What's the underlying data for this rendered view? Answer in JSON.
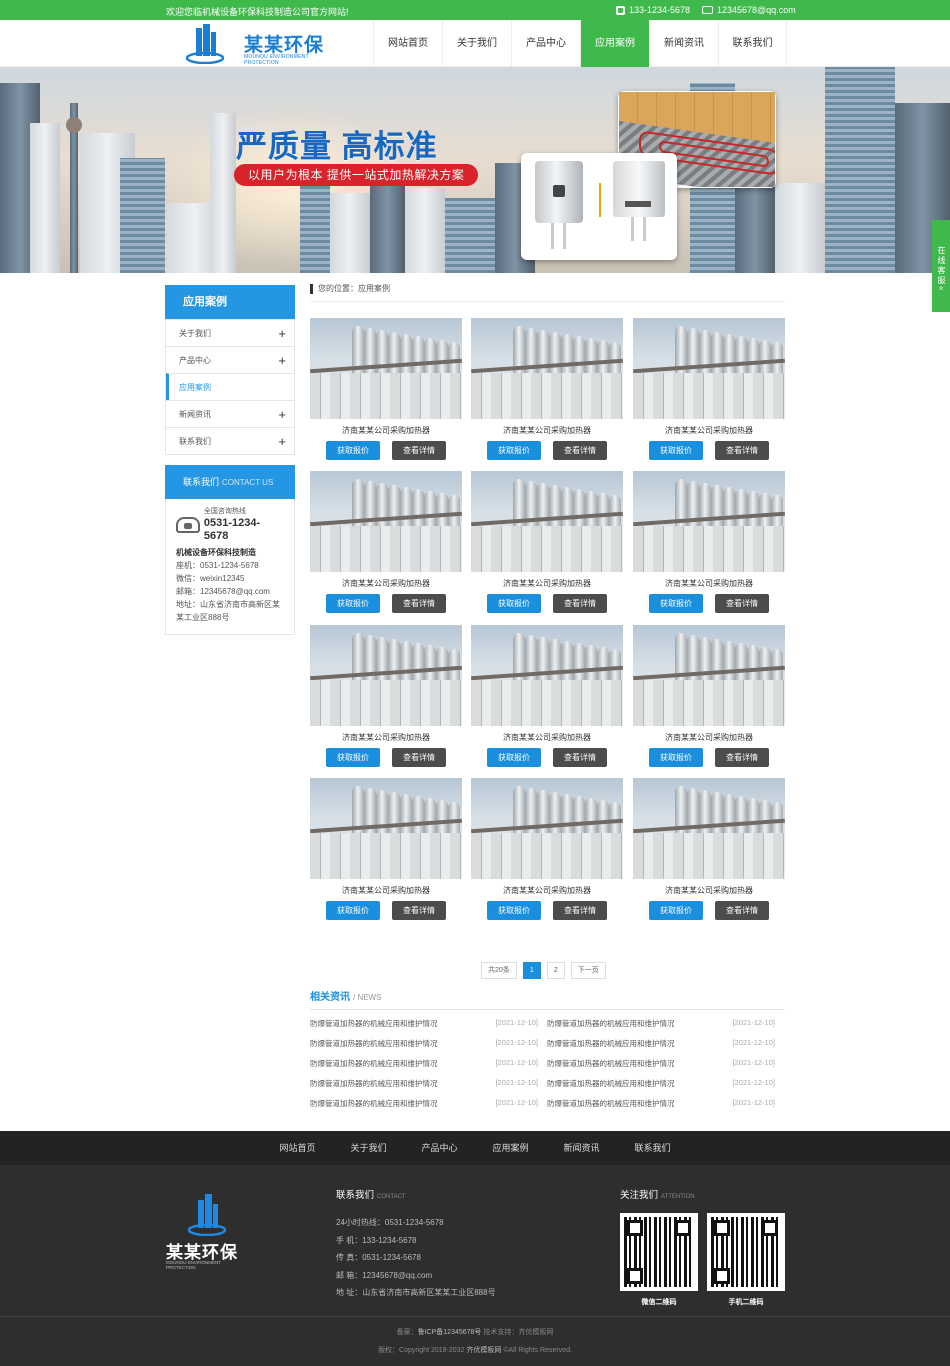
{
  "topbar": {
    "welcome": "欢迎您临机械设备环保科技制造公司官方网站!",
    "phone": "133-1234-5678",
    "email": "12345678@qq.com"
  },
  "header": {
    "logo_name": "某某环保",
    "logo_en": "MOUNOU ENVIRONMENT PROTECTION",
    "nav": [
      "网站首页",
      "关于我们",
      "产品中心",
      "应用案例",
      "新闻资讯",
      "联系我们"
    ],
    "active_nav": "应用案例"
  },
  "banner": {
    "slogan": "严质量 高标准",
    "sub": "以用户为根本 提供一站式加热解决方案"
  },
  "side_tab": "在线客服«",
  "sidebar": {
    "title": "应用案例",
    "items": [
      {
        "label": "关于我们",
        "plus": "+"
      },
      {
        "label": "产品中心",
        "plus": "+"
      },
      {
        "label": "应用案例",
        "plus": ""
      },
      {
        "label": "新闻资讯",
        "plus": "+"
      },
      {
        "label": "联系我们",
        "plus": "+"
      }
    ],
    "contact_title": "联系我们",
    "contact_title_en": "CONTACT US",
    "hotline_label": "全国咨询热线",
    "hotline": "0531-1234-5678",
    "company": "机械设备环保科技制造",
    "tel": "座机：0531-1234-5678",
    "wechat": "微信：weixin12345",
    "mail": "邮箱：12345678@qq.com",
    "address": "地址：山东省济南市高新区某某工业区888号"
  },
  "main": {
    "breadcrumb": "您的位置：应用案例",
    "cards": [
      {
        "title": "济南某某公司采购加热器"
      },
      {
        "title": "济南某某公司采购加热器"
      },
      {
        "title": "济南某某公司采购加热器"
      },
      {
        "title": "济南某某公司采购加热器"
      },
      {
        "title": "济南某某公司采购加热器"
      },
      {
        "title": "济南某某公司采购加热器"
      },
      {
        "title": "济南某某公司采购加热器"
      },
      {
        "title": "济南某某公司采购加热器"
      },
      {
        "title": "济南某某公司采购加热器"
      },
      {
        "title": "济南某某公司采购加热器"
      },
      {
        "title": "济南某某公司采购加热器"
      },
      {
        "title": "济南某某公司采购加热器"
      }
    ],
    "btn_quote": "获取报价",
    "btn_detail": "查看详情",
    "pager": {
      "total": "共20条",
      "pages": [
        "1",
        "2"
      ],
      "current": "1",
      "next": "下一页"
    },
    "news_title": "相关资讯",
    "news_title_en": "/ NEWS",
    "news": [
      {
        "title": "防爆管道加热器的机械应用和维护情况",
        "date": "[2021-12-10]"
      },
      {
        "title": "防爆管道加热器的机械应用和维护情况",
        "date": "[2021-12-10]"
      },
      {
        "title": "防爆管道加热器的机械应用和维护情况",
        "date": "[2021-12-10]"
      },
      {
        "title": "防爆管道加热器的机械应用和维护情况",
        "date": "[2021-12-10]"
      },
      {
        "title": "防爆管道加热器的机械应用和维护情况",
        "date": "[2021-12-10]"
      },
      {
        "title": "防爆管道加热器的机械应用和维护情况",
        "date": "[2021-12-10]"
      },
      {
        "title": "防爆管道加热器的机械应用和维护情况",
        "date": "[2021-12-10]"
      },
      {
        "title": "防爆管道加热器的机械应用和维护情况",
        "date": "[2021-12-10]"
      },
      {
        "title": "防爆管道加热器的机械应用和维护情况",
        "date": "[2021-12-10]"
      },
      {
        "title": "防爆管道加热器的机械应用和维护情况",
        "date": "[2021-12-10]"
      }
    ]
  },
  "footer": {
    "nav": [
      "网站首页",
      "关于我们",
      "产品中心",
      "应用案例",
      "新闻资讯",
      "联系我们"
    ],
    "logo_name": "某某环保",
    "logo_en": "MOUNOU ENVIRONMENT PROTECTION",
    "contact_title": "联系我们",
    "contact_title_en": "CONTACT",
    "contact_lines": [
      "24小时热线：0531-1234-5678",
      "手  机：133-1234-5678",
      "传  真：0531-1234-5678",
      "邮  箱：12345678@qq.com",
      "地  址：山东省济南市高新区某某工业区888号"
    ],
    "follow_title": "关注我们",
    "follow_title_en": "ATTENTION",
    "qr_wechat": "微信二维码",
    "qr_mobile": "手机二维码",
    "record_label": "备案：",
    "record": "鲁ICP备12345678号",
    "support": " 技术支持：齐优模板网",
    "copyright_label": "版权：Copyright 2018-2032 ",
    "copyright_owner": "齐优模板网",
    "copyright_tail": " ©All Rights Reserved."
  },
  "colors": {
    "green": "#3fb94b",
    "blue": "#2596e3",
    "red": "#d8232a"
  }
}
